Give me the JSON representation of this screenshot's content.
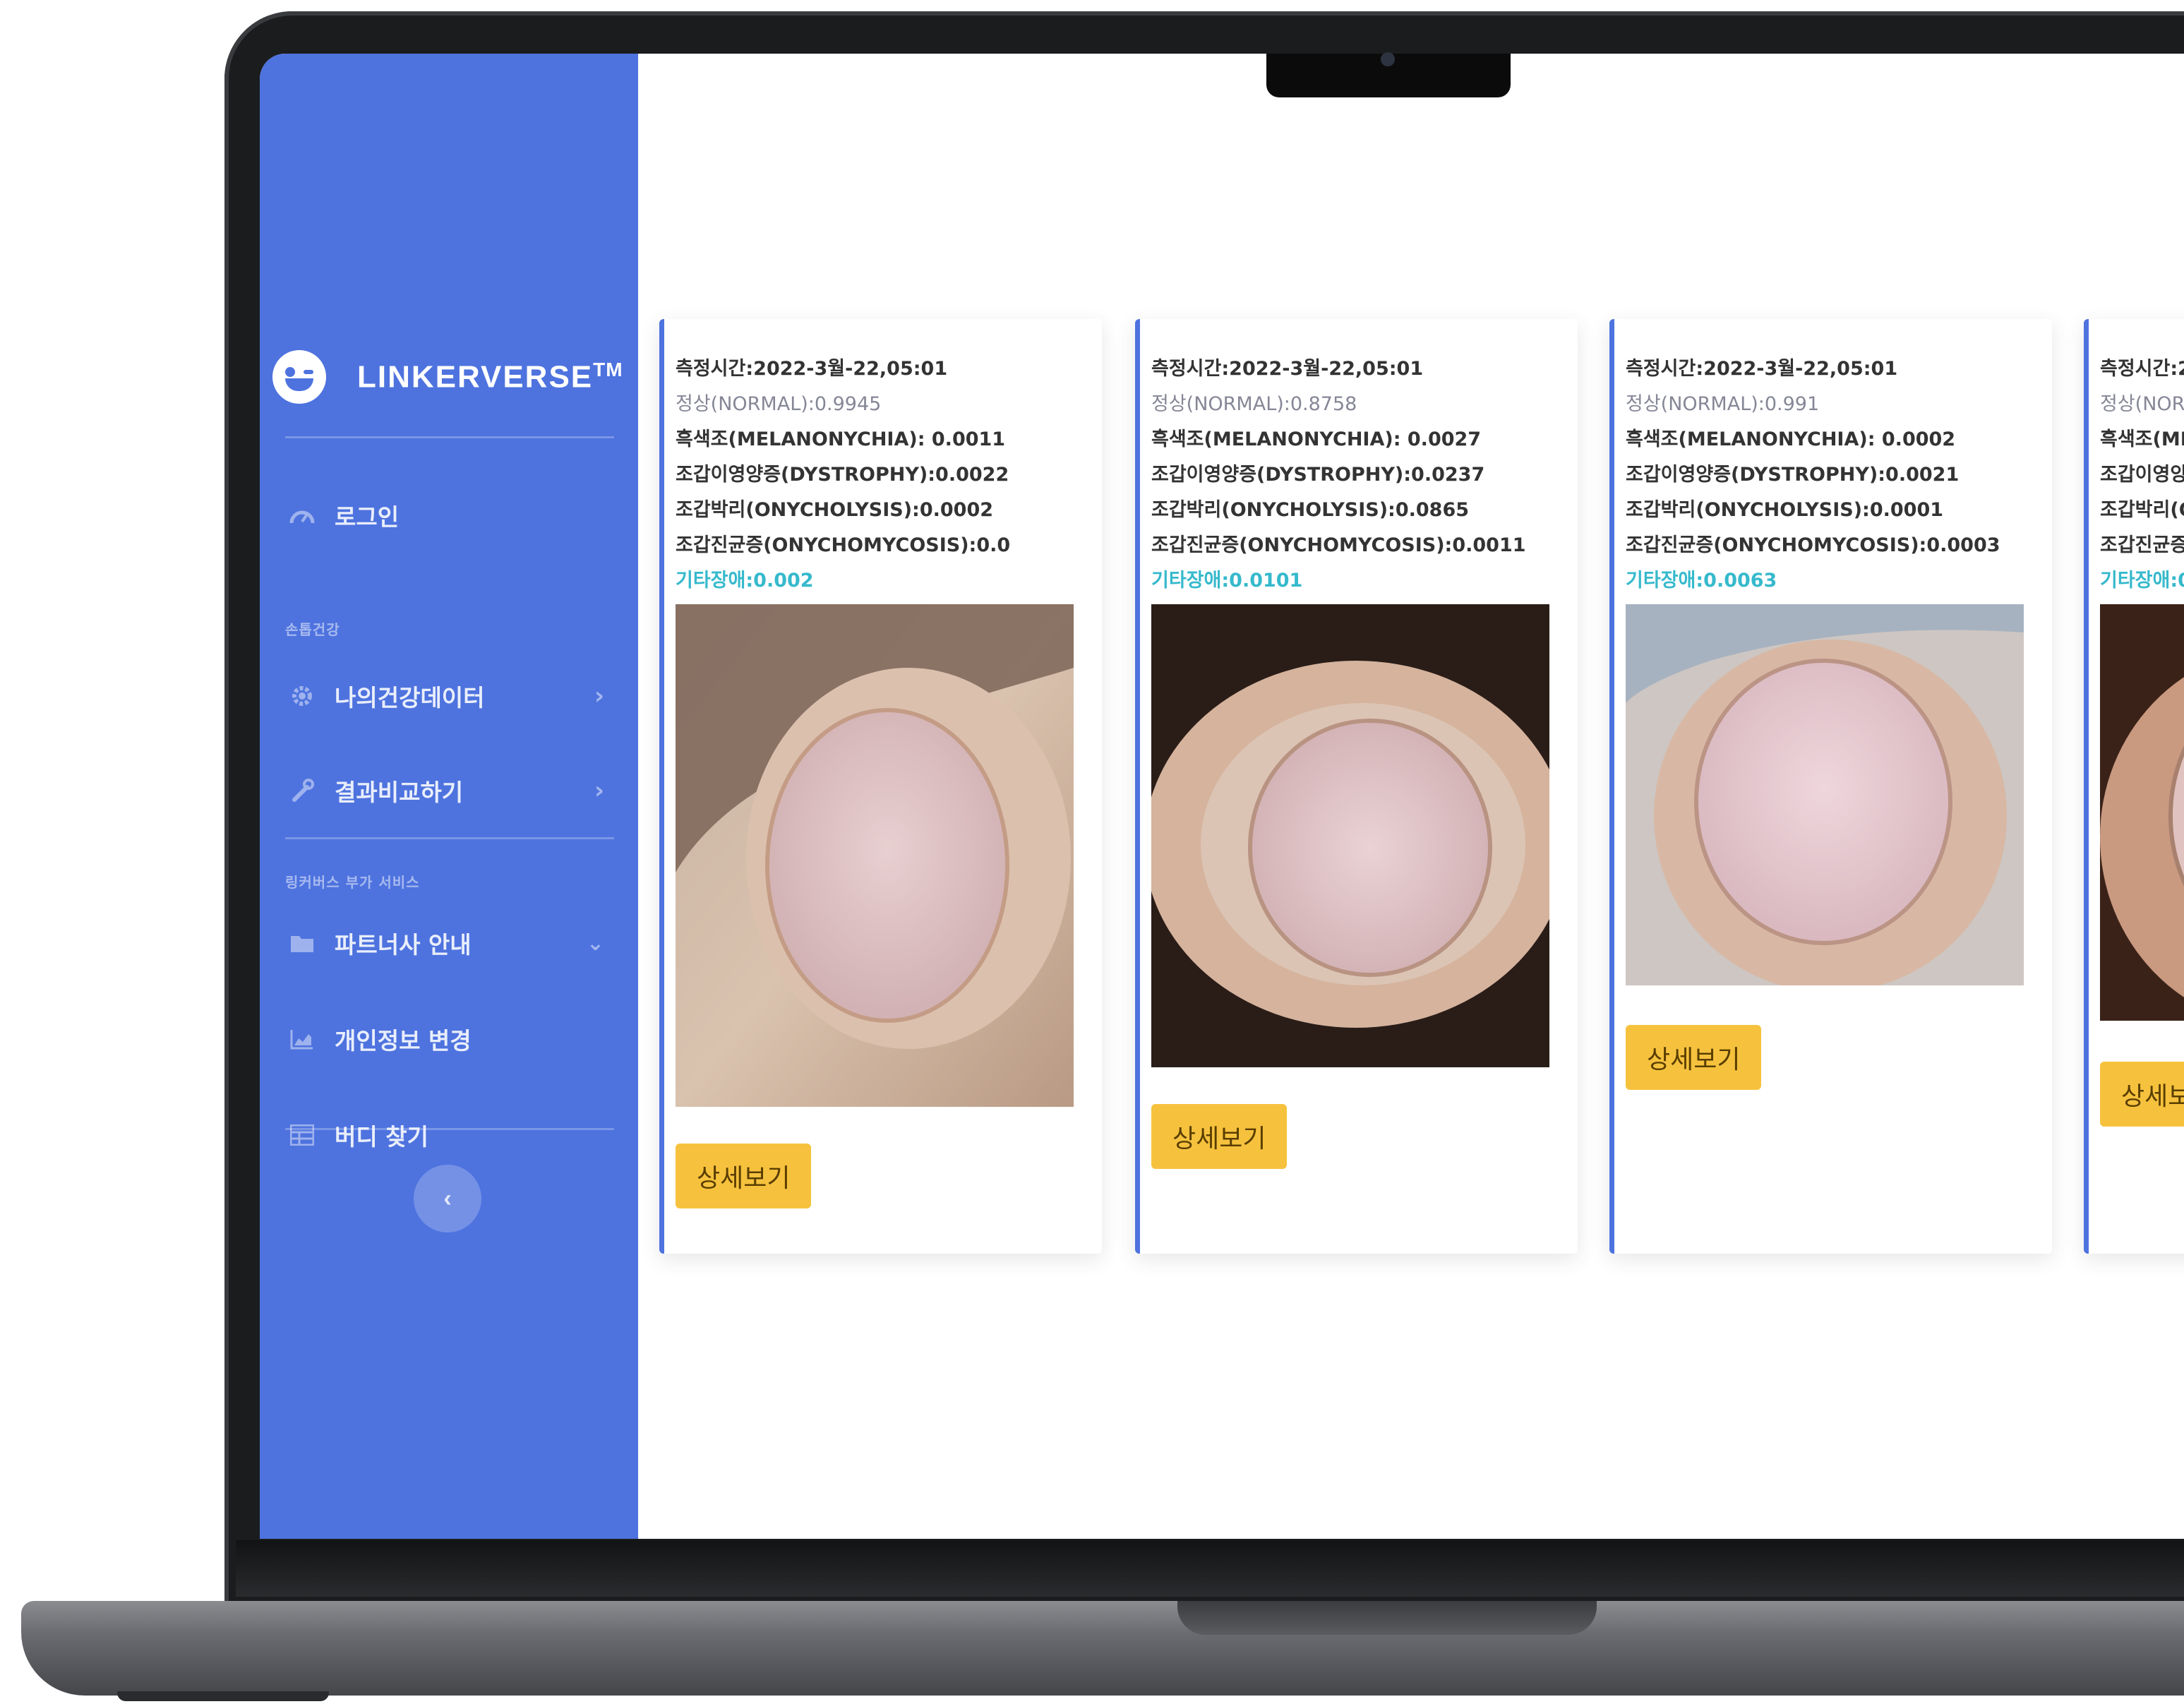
{
  "sidebar": {
    "brand": "LINKERVERSE",
    "brand_mark": "TM",
    "items": [
      {
        "label": "로그인",
        "icon": "tachometer-icon"
      },
      {
        "label": "나의건강데이터",
        "icon": "cog-icon"
      },
      {
        "label": "결과비교하기",
        "icon": "wrench-icon"
      },
      {
        "label": "파트너사 안내",
        "icon": "folder-icon"
      },
      {
        "label": "개인정보 변경",
        "icon": "chart-area-icon"
      },
      {
        "label": "버디 찾기",
        "icon": "table-icon"
      }
    ],
    "sections": [
      "손톱건강",
      "링커버스 부가 서비스"
    ],
    "collapse_icon": "chevron-left-icon",
    "collapse_label": "‹"
  },
  "cards": [
    {
      "time": "측정시간:2022-3월-22,05:01",
      "normal": "정상(NORMAL):0.9945",
      "melanonychia": "흑색조(MELANONYCHIA): 0.0011",
      "dystrophy": "조갑이영양증(DYSTROPHY):0.0022",
      "onycholysis": "조갑박리(ONYCHOLYSIS):0.0002",
      "onychomycosis": "조갑진균증(ONYCHOMYCOSIS):0.0",
      "etc": "기타장애:0.002",
      "button": "상세보기"
    },
    {
      "time": "측정시간:2022-3월-22,05:01",
      "normal": "정상(NORMAL):0.8758",
      "melanonychia": "흑색조(MELANONYCHIA): 0.0027",
      "dystrophy": "조갑이영양증(DYSTROPHY):0.0237",
      "onycholysis": "조갑박리(ONYCHOLYSIS):0.0865",
      "onychomycosis": "조갑진균증(ONYCHOMYCOSIS):0.0011",
      "etc": "기타장애:0.0101",
      "button": "상세보기"
    },
    {
      "time": "측정시간:2022-3월-22,05:01",
      "normal": "정상(NORMAL):0.991",
      "melanonychia": "흑색조(MELANONYCHIA): 0.0002",
      "dystrophy": "조갑이영양증(DYSTROPHY):0.0021",
      "onycholysis": "조갑박리(ONYCHOLYSIS):0.0001",
      "onychomycosis": "조갑진균증(ONYCHOMYCOSIS):0.0003",
      "etc": "기타장애:0.0063",
      "button": "상세보기"
    },
    {
      "time": "측정시간:2",
      "normal": "정상(NOR",
      "melanonychia": "흑색조(ME",
      "dystrophy": "조갑이영양",
      "onycholysis": "조갑박리(O",
      "onychomycosis": "조갑진균증(",
      "etc": "기타장애:0.",
      "button": "상세보"
    }
  ],
  "colors": {
    "sidebar": "#4e73df",
    "button": "#f6c23e",
    "etc_text": "#36b9cc",
    "normal_text": "#858796"
  }
}
